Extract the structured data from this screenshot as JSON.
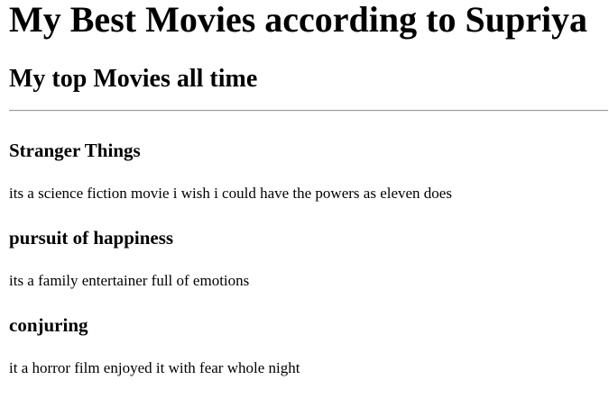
{
  "page": {
    "title": "My Best Movies according to Supriya",
    "subtitle": "My top Movies all time"
  },
  "movies": [
    {
      "title": "Stranger Things",
      "description": "its a science fiction movie i wish i could have the powers as eleven does"
    },
    {
      "title": "pursuit of happiness",
      "description": "its a family entertainer full of emotions"
    },
    {
      "title": "conjuring",
      "description": "it a horror film enjoyed it with fear whole night"
    }
  ]
}
